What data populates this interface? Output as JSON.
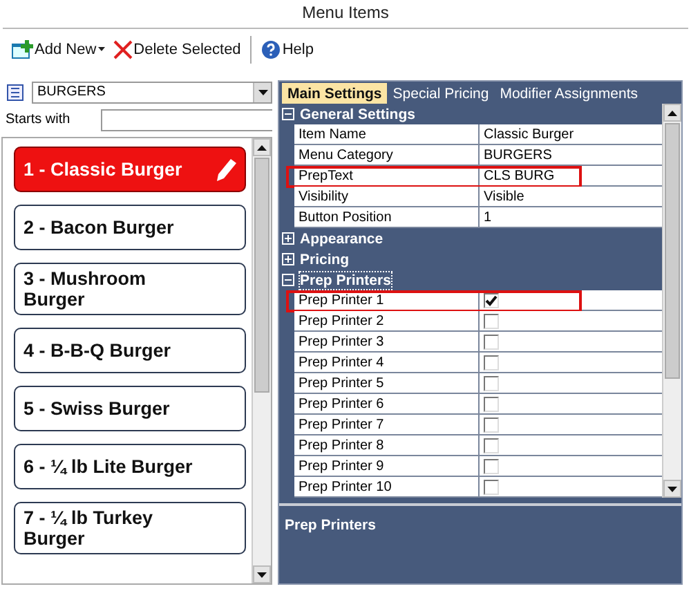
{
  "window": {
    "title": "Menu Items"
  },
  "toolbar": [
    {
      "kind": "add",
      "label": "Add New",
      "dropdown": true
    },
    {
      "kind": "delete",
      "label": "Delete Selected",
      "dropdown": false
    },
    {
      "kind": "help",
      "label": "Help",
      "dropdown": false
    }
  ],
  "category": {
    "value": "BURGERS"
  },
  "filter": {
    "label": "Starts with"
  },
  "items": [
    {
      "label": "1 - Classic Burger",
      "selected": true
    },
    {
      "label": "2 - Bacon Burger",
      "selected": false
    },
    {
      "label": "3 - Mushroom Burger",
      "selected": false
    },
    {
      "label": "4 - B-B-Q Burger",
      "selected": false
    },
    {
      "label": "5 - Swiss Burger",
      "selected": false
    },
    {
      "label": "6 - ¼ lb Lite Burger",
      "selected": false
    },
    {
      "label": "7 - ¼ lb Turkey Burger",
      "selected": false
    }
  ],
  "tabs": [
    {
      "label": "Main Settings",
      "selected": true
    },
    {
      "label": "Special Pricing",
      "selected": false
    },
    {
      "label": "Modifier Assignments",
      "selected": false
    }
  ],
  "groups": [
    {
      "title": "General Settings",
      "expanded": true,
      "focused": false,
      "rows": [
        {
          "kind": "text",
          "name": "Item Name",
          "value": "Classic Burger",
          "highlighted": false
        },
        {
          "kind": "text",
          "name": "Menu Category",
          "value": "BURGERS",
          "highlighted": false
        },
        {
          "kind": "text",
          "name": "PrepText",
          "value": "CLS BURG",
          "highlighted": true
        },
        {
          "kind": "text",
          "name": "Visibility",
          "value": "Visible",
          "highlighted": false
        },
        {
          "kind": "text",
          "name": "Button Position",
          "value": "1",
          "highlighted": false
        }
      ]
    },
    {
      "title": "Appearance",
      "expanded": false,
      "focused": false
    },
    {
      "title": "Pricing",
      "expanded": false,
      "focused": false
    },
    {
      "title": "Prep Printers",
      "expanded": true,
      "focused": true,
      "rows": [
        {
          "kind": "checkbox",
          "name": "Prep Printer 1",
          "checked": true,
          "highlighted": true
        },
        {
          "kind": "checkbox",
          "name": "Prep Printer 2",
          "checked": false,
          "highlighted": false
        },
        {
          "kind": "checkbox",
          "name": "Prep Printer 3",
          "checked": false,
          "highlighted": false
        },
        {
          "kind": "checkbox",
          "name": "Prep Printer 4",
          "checked": false,
          "highlighted": false
        },
        {
          "kind": "checkbox",
          "name": "Prep Printer 5",
          "checked": false,
          "highlighted": false
        },
        {
          "kind": "checkbox",
          "name": "Prep Printer 6",
          "checked": false,
          "highlighted": false
        },
        {
          "kind": "checkbox",
          "name": "Prep Printer 7",
          "checked": false,
          "highlighted": false
        },
        {
          "kind": "checkbox",
          "name": "Prep Printer 8",
          "checked": false,
          "highlighted": false
        },
        {
          "kind": "checkbox",
          "name": "Prep Printer 9",
          "checked": false,
          "highlighted": false
        },
        {
          "kind": "checkbox",
          "name": "Prep Printer 10",
          "checked": false,
          "highlighted": false
        }
      ]
    }
  ],
  "description": {
    "title": "Prep Printers"
  }
}
